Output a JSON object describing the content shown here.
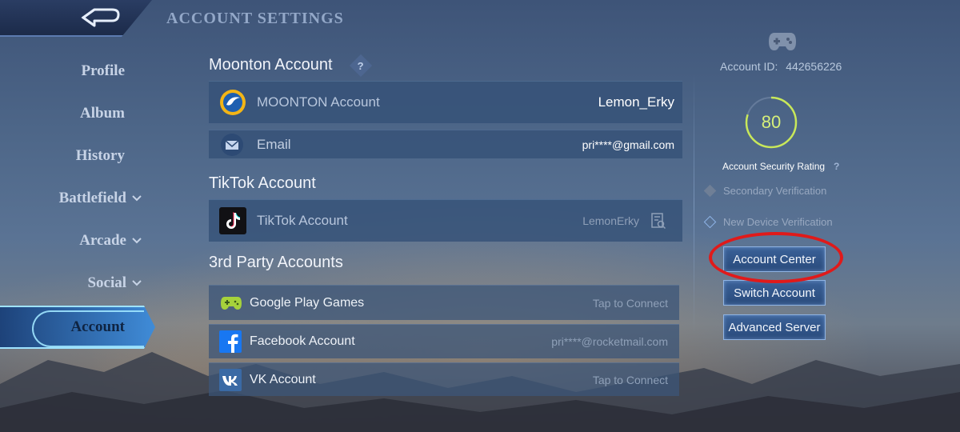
{
  "header": {
    "title": "ACCOUNT SETTINGS",
    "back_icon": "back-arrow-icon"
  },
  "nav": {
    "items": [
      {
        "label": "Profile",
        "expandable": false
      },
      {
        "label": "Album",
        "expandable": false
      },
      {
        "label": "History",
        "expandable": false
      },
      {
        "label": "Battlefield",
        "expandable": true
      },
      {
        "label": "Arcade",
        "expandable": true
      },
      {
        "label": "Social",
        "expandable": true
      },
      {
        "label": "Account",
        "expandable": false,
        "active": true
      }
    ]
  },
  "moonton": {
    "title": "Moonton Account",
    "help": "?",
    "rows": [
      {
        "label": "MOONTON Account",
        "value": "Lemon_Erky",
        "icon": "moonton-logo-icon"
      },
      {
        "label": "Email",
        "value": "pri****@gmail.com",
        "icon": "mail-icon"
      }
    ]
  },
  "tiktok": {
    "title": "TikTok Account",
    "row": {
      "label": "TikTok Account",
      "value": "LemonErky",
      "icon": "tiktok-logo-icon",
      "action_icon": "details-search-icon"
    }
  },
  "third_party": {
    "title": "3rd Party Accounts",
    "rows": [
      {
        "label": "Google Play Games",
        "value": "Tap to Connect",
        "icon": "gamepad-icon"
      },
      {
        "label": "Facebook Account",
        "value": "pri****@rocketmail.com",
        "icon": "facebook-icon"
      },
      {
        "label": "VK Account",
        "value": "Tap to Connect",
        "icon": "vk-icon"
      }
    ]
  },
  "security": {
    "account_id_label": "Account ID:",
    "account_id": "442656226",
    "rating": 80,
    "rating_max": 100,
    "rating_label": "Account Security Rating",
    "rating_help": "?",
    "secondary_verification": "Secondary Verification",
    "new_device_verification": "New Device Verification"
  },
  "buttons": {
    "account_center": "Account Center",
    "switch_account": "Switch Account",
    "advanced_server": "Advanced Server"
  },
  "colors": {
    "highlight_ring": "#e01a1a",
    "gauge": "#c8e85a",
    "accent": "#7fd0ff"
  }
}
